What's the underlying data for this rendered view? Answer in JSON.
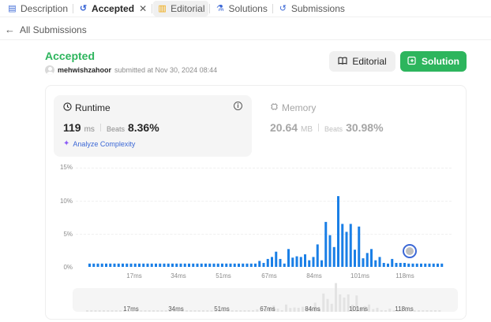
{
  "tabs": [
    {
      "label": "Description",
      "icon": "document-icon"
    },
    {
      "label": "Accepted",
      "icon": "history-icon",
      "active": true,
      "close": "✕"
    },
    {
      "label": "Editorial",
      "icon": "book-icon"
    },
    {
      "label": "Solutions",
      "icon": "flask-icon"
    },
    {
      "label": "Submissions",
      "icon": "history-icon"
    }
  ],
  "nav": {
    "back_label": "All Submissions"
  },
  "submission": {
    "status": "Accepted",
    "user": "mehwishzahoor",
    "submitted_text": "submitted at Nov 30, 2024 08:44"
  },
  "buttons": {
    "editorial": "Editorial",
    "solution": "Solution"
  },
  "runtime": {
    "title": "Runtime",
    "value": "119",
    "unit": "ms",
    "beats_label": "Beats",
    "beats_value": "8.36%",
    "analyze_label": "Analyze Complexity"
  },
  "memory": {
    "title": "Memory",
    "value": "20.64",
    "unit": "MB",
    "beats_label": "Beats",
    "beats_value": "30.98%"
  },
  "colors": {
    "accent_green": "#2db55d",
    "bar_blue": "#1a7fe6",
    "link_blue": "#3c68d6"
  },
  "chart_data": {
    "type": "bar",
    "x_tick_labels": [
      "17ms",
      "34ms",
      "51ms",
      "67ms",
      "84ms",
      "101ms",
      "118ms"
    ],
    "y_tick_labels": [
      "15%",
      "10%",
      "5%",
      "0%"
    ],
    "ylim": [
      0,
      15
    ],
    "grid": true,
    "values": [
      0.5,
      0.5,
      0.5,
      0.5,
      0.5,
      0.5,
      0.5,
      0.5,
      0.5,
      0.5,
      0.5,
      0.5,
      0.5,
      0.5,
      0.5,
      0.5,
      0.5,
      0.5,
      0.5,
      0.5,
      0.5,
      0.5,
      0.5,
      0.5,
      0.5,
      0.5,
      0.5,
      0.5,
      0.5,
      0.5,
      0.5,
      0.5,
      0.5,
      0.5,
      0.5,
      0.5,
      0.5,
      0.5,
      0.5,
      0.5,
      0.5,
      0.9,
      0.6,
      1.2,
      1.5,
      2.3,
      1.2,
      0.5,
      2.7,
      1.4,
      1.6,
      1.5,
      1.9,
      1.0,
      1.5,
      3.4,
      1.0,
      6.8,
      4.8,
      3.0,
      10.7,
      6.5,
      5.3,
      6.5,
      2.6,
      6.1,
      1.3,
      2.1,
      2.7,
      1.0,
      1.5,
      0.6,
      0.5,
      1.2,
      0.6,
      0.6,
      0.6,
      0.5,
      0.5,
      0.5,
      0.5,
      0.5,
      0.5,
      0.5,
      0.5,
      0.5
    ],
    "highlight_label": "118ms"
  }
}
